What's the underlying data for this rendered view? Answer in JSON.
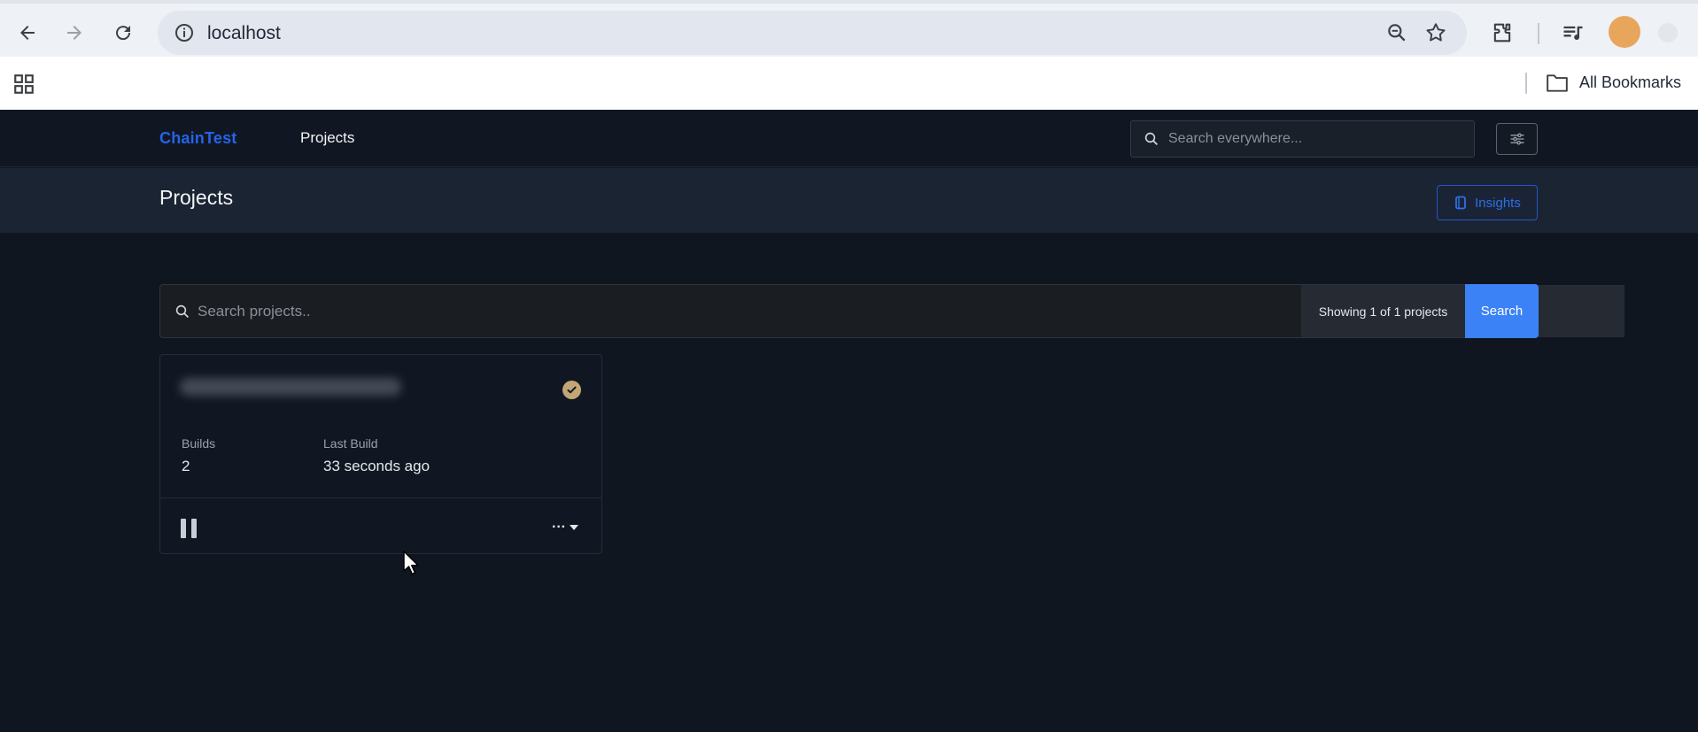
{
  "browser": {
    "url": "localhost",
    "bookmarks_label": "All Bookmarks"
  },
  "app": {
    "brand": "ChainTest",
    "nav": [
      "Projects"
    ],
    "global_search_placeholder": "Search everywhere...",
    "page_title": "Projects",
    "insights_label": "Insights"
  },
  "project_search": {
    "placeholder": "Search projects..",
    "showing_text": "Showing 1 of 1 projects",
    "button_label": "Search"
  },
  "projects": [
    {
      "status": "passed",
      "builds_label": "Builds",
      "builds": "2",
      "last_build_label": "Last Build",
      "last_build": "33 seconds ago",
      "more_label": "···"
    }
  ],
  "colors": {
    "accent": "#2563eb",
    "search_button": "#3b82f6",
    "status_check": "#c3a676",
    "background": "#0f1620"
  },
  "icons": [
    "back-arrow-icon",
    "forward-arrow-icon",
    "reload-icon",
    "info-icon",
    "zoom-icon",
    "star-icon",
    "extensions-icon",
    "media-icon",
    "apps-grid-icon",
    "folder-icon",
    "search-icon",
    "sliders-icon",
    "insights-icon",
    "check-icon",
    "pause-icon",
    "caret-down-icon",
    "cursor-icon"
  ]
}
